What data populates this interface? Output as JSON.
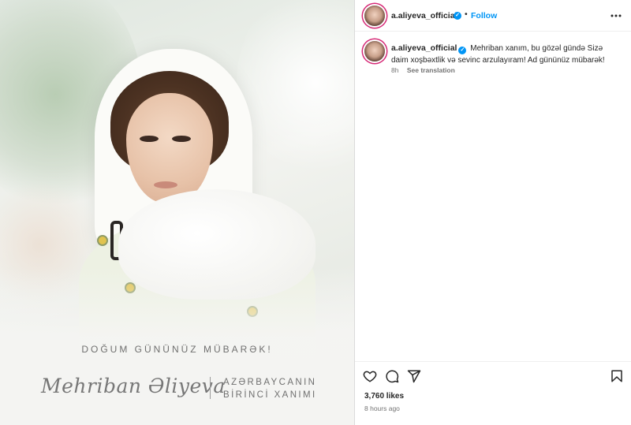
{
  "post_image": {
    "greeting": "DOĞUM GÜNÜNÜZ MÜBARƏK!",
    "signature": "Mehriban Əliyeva",
    "title_line1": "AZƏRBAYCANIN",
    "title_line2": "BİRİNCİ XANIMI"
  },
  "header": {
    "username": "a.aliyeva_official",
    "separator": "•",
    "follow_label": "Follow",
    "more_icon": "more-horizontal-icon"
  },
  "caption": {
    "username": "a.aliyeva_official",
    "text": "Mehriban xanım, bu gözəl gündə Sizə daim xoşbəxtlik və sevinc arzulayıram! Ad gününüz mübarək!",
    "age": "8h",
    "see_translation": "See translation"
  },
  "actions": {
    "like_icon": "heart-icon",
    "comment_icon": "comment-icon",
    "share_icon": "paper-plane-icon",
    "save_icon": "bookmark-icon"
  },
  "stats": {
    "likes": "3,760 likes",
    "time": "8 hours ago"
  },
  "colors": {
    "accent": "#0095f6",
    "text": "#262626",
    "muted": "#737373"
  }
}
